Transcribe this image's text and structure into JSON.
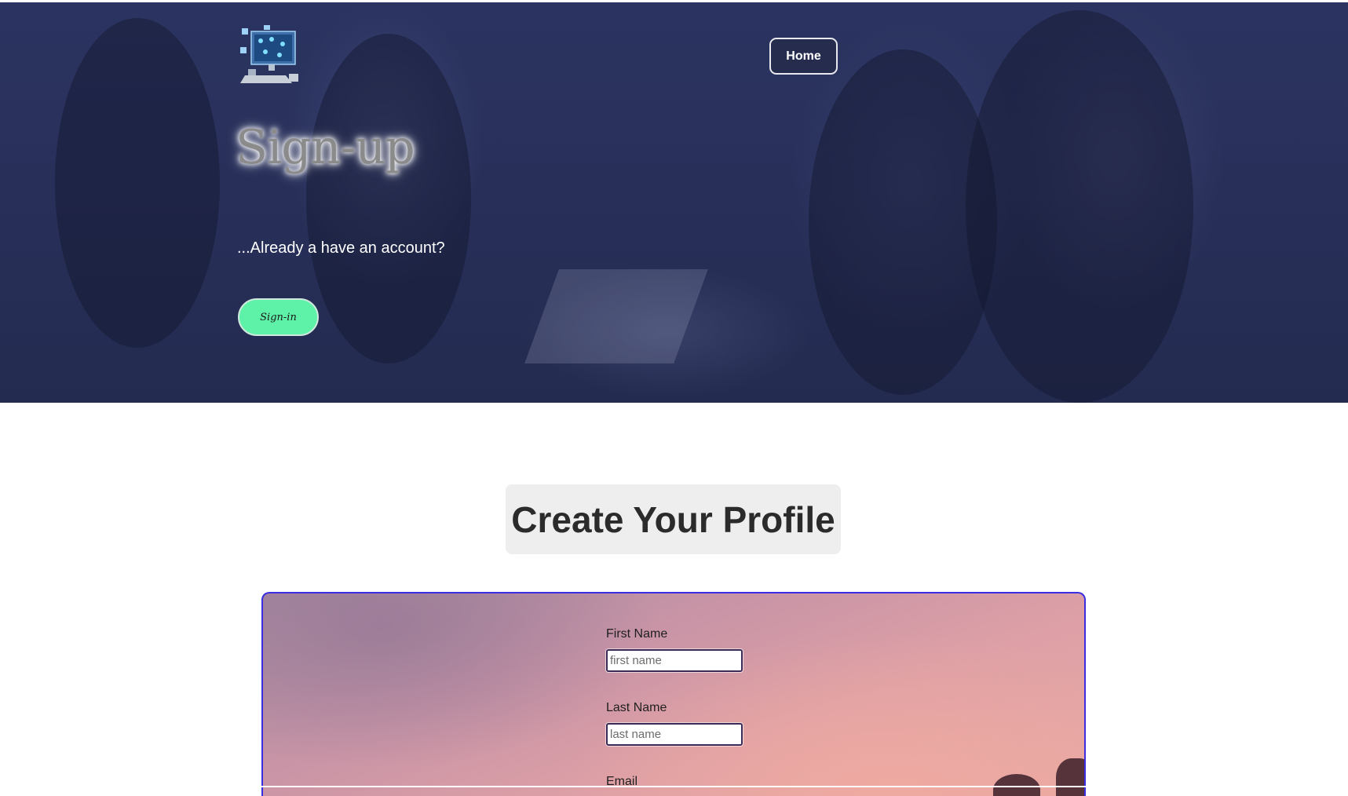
{
  "header": {
    "logo_icon": "computer-network-icon",
    "home_label": "Home"
  },
  "hero": {
    "title": "Sign-up",
    "subtitle": "...Already a have an account?",
    "signin_label": "Sign-in"
  },
  "profile": {
    "heading": "Create Your Profile"
  },
  "form": {
    "first_name_label": "First Name",
    "first_name_placeholder": "first name",
    "last_name_label": "Last Name",
    "last_name_placeholder": "last name",
    "email_label": "Email"
  },
  "colors": {
    "hero_bg": "#28305a",
    "signin_bg": "#5df2a8",
    "panel_border": "#3a2ee0",
    "heading_bg": "#eeeeee"
  }
}
